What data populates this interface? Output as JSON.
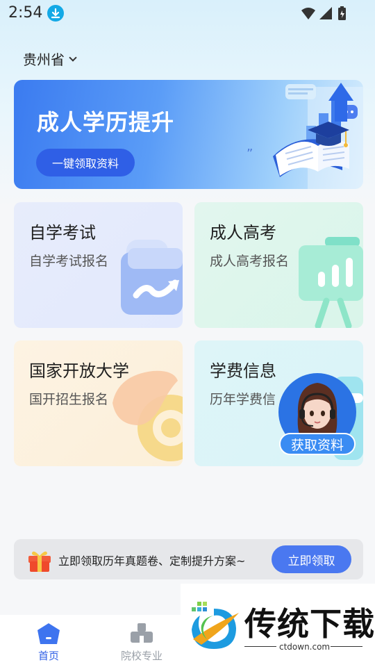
{
  "status_bar": {
    "time": "2:54"
  },
  "header": {
    "province": "贵州省"
  },
  "banner": {
    "title": "成人学历提升",
    "button_label": "一键领取资料"
  },
  "cards": [
    {
      "title": "自学考试",
      "subtitle": "自学考试报名"
    },
    {
      "title": "成人高考",
      "subtitle": "成人高考报名"
    },
    {
      "title": "国家开放大学",
      "subtitle": "国开招生报名"
    },
    {
      "title": "学费信息",
      "subtitle": "历年学费信"
    }
  ],
  "advisor": {
    "button_label": "获取资料"
  },
  "promo": {
    "text": "立即领取历年真题卷、定制提升方案~",
    "button_label": "立即领取"
  },
  "tabbar": {
    "tabs": [
      {
        "label": "首页",
        "active": true
      },
      {
        "label": "院校专业",
        "active": false
      }
    ]
  },
  "watermark": {
    "title": "传统下载",
    "url": "ctdown.com"
  },
  "colors": {
    "accent": "#4a78f0",
    "active_tab": "#2f5fe6",
    "inactive_tab": "#9aa0a8"
  }
}
